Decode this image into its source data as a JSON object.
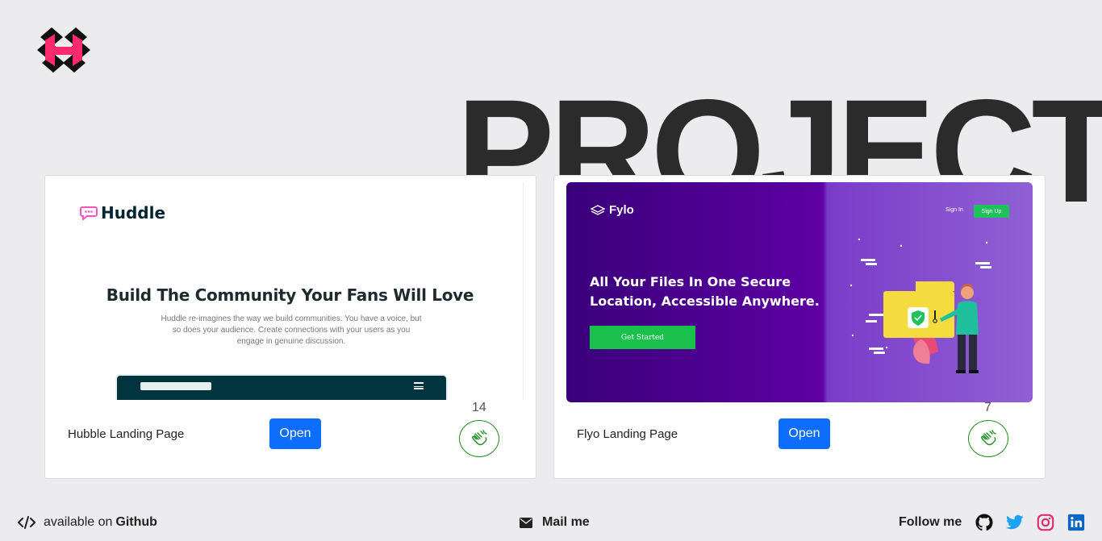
{
  "page": {
    "title": "PROJECTS"
  },
  "projects": [
    {
      "title": "Hubble Landing Page",
      "open_label": "Open",
      "claps": "14",
      "preview": {
        "brand": "Huddle",
        "headline": "Build The Community Your Fans Will Love",
        "body": "Huddle re-imagines the way we build communities. You have a voice, but so does your audience. Create connections with your users as you engage in genuine discussion."
      }
    },
    {
      "title": "Flyo Landing Page",
      "open_label": "Open",
      "claps": "7",
      "preview": {
        "brand": "Fylo",
        "signin": "Sign In",
        "signup": "Sign Up",
        "headline": "All Your Files In One Secure Location, Accessible Anywhere.",
        "cta": "Get Started"
      }
    }
  ],
  "footer": {
    "github_prefix": "available on",
    "github_label": "Github",
    "mail_label": "Mail me",
    "follow_label": "Follow me"
  },
  "colors": {
    "background": "#ececee",
    "primary_button": "#0d6efd",
    "clap_green": "#1e8a1e",
    "twitter": "#1da1f2",
    "instagram": "#e1306c",
    "linkedin": "#0a66c2"
  },
  "icons": [
    "logo-icon",
    "code-icon",
    "mail-icon",
    "github-icon",
    "twitter-icon",
    "instagram-icon",
    "linkedin-icon",
    "clap-icon"
  ]
}
